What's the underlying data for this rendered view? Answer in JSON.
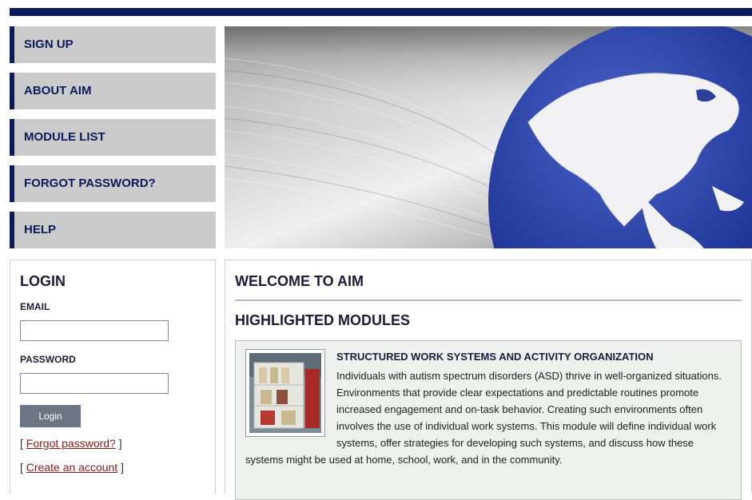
{
  "nav": {
    "items": [
      {
        "label": "SIGN UP"
      },
      {
        "label": "ABOUT AIM"
      },
      {
        "label": "MODULE LIST"
      },
      {
        "label": "FORGOT PASSWORD?"
      },
      {
        "label": "HELP"
      }
    ]
  },
  "login": {
    "title": "LOGIN",
    "email_label": "EMAIL",
    "email_value": "",
    "password_label": "PASSWORD",
    "password_value": "",
    "submit_label": "Login",
    "forgot_prefix": "[ ",
    "forgot_link": "Forgot password?",
    "forgot_suffix": " ]",
    "create_prefix": "[ ",
    "create_link": "Create an account",
    "create_suffix": " ]"
  },
  "main": {
    "welcome_title": "WELCOME TO AIM",
    "highlighted_title": "HIGHLIGHTED MODULES",
    "module": {
      "title": "STRUCTURED WORK SYSTEMS AND ACTIVITY ORGANIZATION",
      "description": "Individuals with autism spectrum disorders (ASD) thrive in well-organized situations. Environments that provide clear expectations and predictable routines promote increased engagement and on-task behavior. Creating such environments often involves the use of individual work systems. This module will define individual work systems, offer strategies for developing such systems, and discuss how these systems might be used at home, school, work, and in the community."
    }
  },
  "colors": {
    "brand_navy": "#0d1a5c",
    "nav_bg": "#cbcbcb",
    "link": "#8b1a1a",
    "button": "#6c7583",
    "module_bg": "#eef1ee"
  }
}
